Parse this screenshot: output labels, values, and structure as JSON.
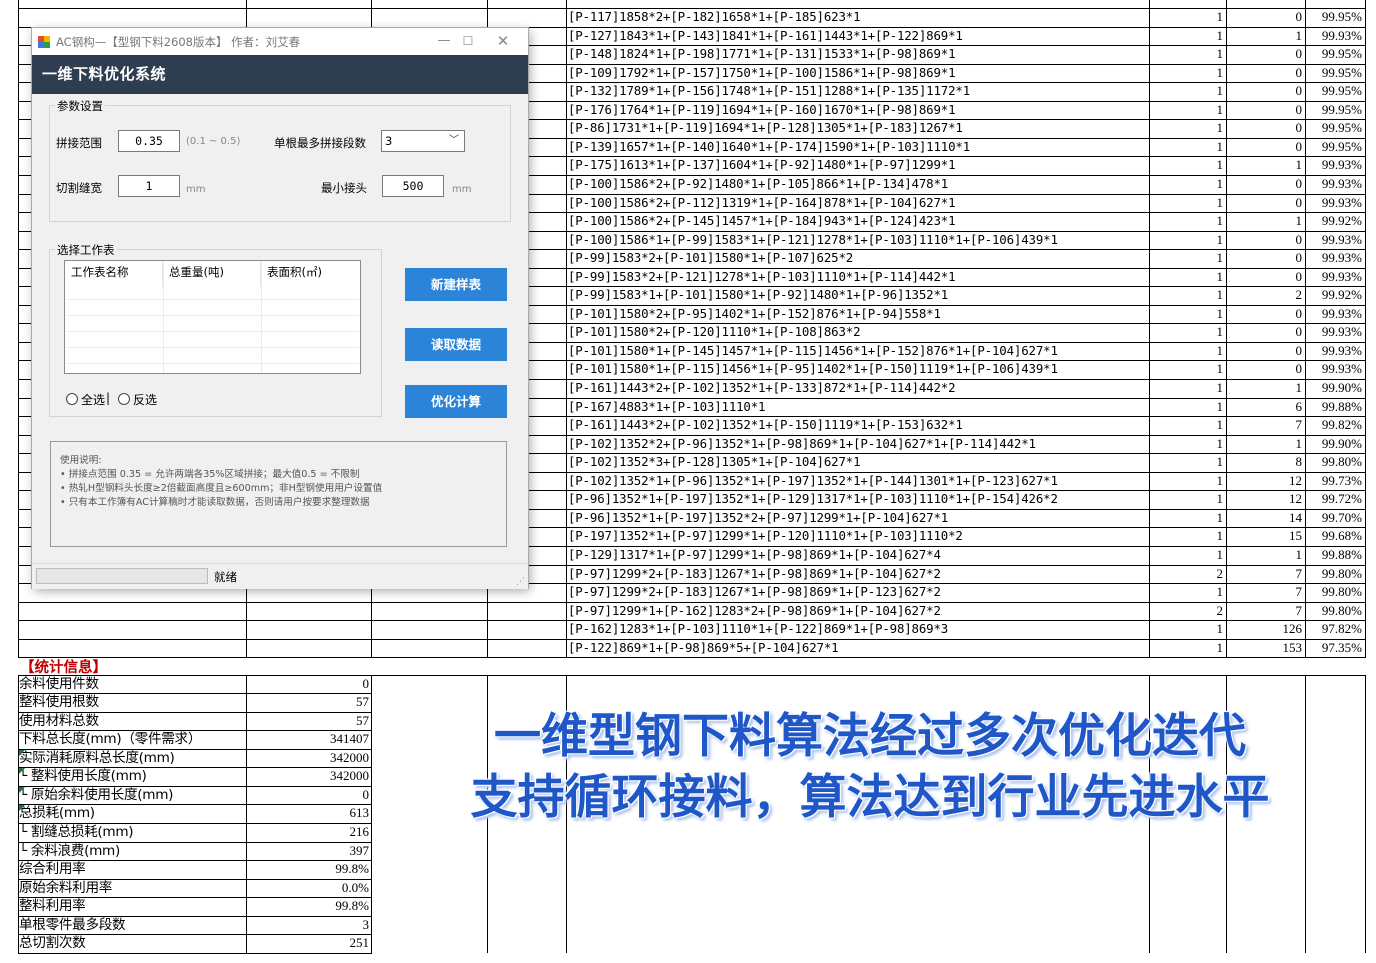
{
  "patterns": [
    {
      "text": "[P-117]1858*2+[P-182]1658*1+[P-185]623*1",
      "count": "1",
      "remnant": "0",
      "rate": "99.95%"
    },
    {
      "text": "[P-127]1843*1+[P-143]1841*1+[P-161]1443*1+[P-122]869*1",
      "count": "1",
      "remnant": "1",
      "rate": "99.93%"
    },
    {
      "text": "[P-148]1824*1+[P-198]1771*1+[P-131]1533*1+[P-98]869*1",
      "count": "1",
      "remnant": "0",
      "rate": "99.95%"
    },
    {
      "text": "[P-109]1792*1+[P-157]1750*1+[P-100]1586*1+[P-98]869*1",
      "count": "1",
      "remnant": "0",
      "rate": "99.95%"
    },
    {
      "text": "[P-132]1789*1+[P-156]1748*1+[P-151]1288*1+[P-135]1172*1",
      "count": "1",
      "remnant": "0",
      "rate": "99.95%"
    },
    {
      "text": "[P-176]1764*1+[P-119]1694*1+[P-160]1670*1+[P-98]869*1",
      "count": "1",
      "remnant": "0",
      "rate": "99.95%"
    },
    {
      "text": "[P-86]1731*1+[P-119]1694*1+[P-128]1305*1+[P-183]1267*1",
      "count": "1",
      "remnant": "0",
      "rate": "99.95%"
    },
    {
      "text": "[P-139]1657*1+[P-140]1640*1+[P-174]1590*1+[P-103]1110*1",
      "count": "1",
      "remnant": "0",
      "rate": "99.95%"
    },
    {
      "text": "[P-175]1613*1+[P-137]1604*1+[P-92]1480*1+[P-97]1299*1",
      "count": "1",
      "remnant": "1",
      "rate": "99.93%"
    },
    {
      "text": "[P-100]1586*2+[P-92]1480*1+[P-105]866*1+[P-134]478*1",
      "count": "1",
      "remnant": "0",
      "rate": "99.93%"
    },
    {
      "text": "[P-100]1586*2+[P-112]1319*1+[P-164]878*1+[P-104]627*1",
      "count": "1",
      "remnant": "0",
      "rate": "99.93%"
    },
    {
      "text": "[P-100]1586*2+[P-145]1457*1+[P-184]943*1+[P-124]423*1",
      "count": "1",
      "remnant": "1",
      "rate": "99.92%"
    },
    {
      "text": "[P-100]1586*1+[P-99]1583*1+[P-121]1278*1+[P-103]1110*1+[P-106]439*1",
      "count": "1",
      "remnant": "0",
      "rate": "99.93%"
    },
    {
      "text": "[P-99]1583*2+[P-101]1580*1+[P-107]625*2",
      "count": "1",
      "remnant": "0",
      "rate": "99.93%"
    },
    {
      "text": "[P-99]1583*2+[P-121]1278*1+[P-103]1110*1+[P-114]442*1",
      "count": "1",
      "remnant": "0",
      "rate": "99.93%"
    },
    {
      "text": "[P-99]1583*1+[P-101]1580*1+[P-92]1480*1+[P-96]1352*1",
      "count": "1",
      "remnant": "2",
      "rate": "99.92%"
    },
    {
      "text": "[P-101]1580*2+[P-95]1402*1+[P-152]876*1+[P-94]558*1",
      "count": "1",
      "remnant": "0",
      "rate": "99.93%"
    },
    {
      "text": "[P-101]1580*2+[P-120]1110*1+[P-108]863*2",
      "count": "1",
      "remnant": "0",
      "rate": "99.93%"
    },
    {
      "text": "[P-101]1580*1+[P-145]1457*1+[P-115]1456*1+[P-152]876*1+[P-104]627*1",
      "count": "1",
      "remnant": "0",
      "rate": "99.93%"
    },
    {
      "text": "[P-101]1580*1+[P-115]1456*1+[P-95]1402*1+[P-150]1119*1+[P-106]439*1",
      "count": "1",
      "remnant": "0",
      "rate": "99.93%"
    },
    {
      "text": "[P-161]1443*2+[P-102]1352*1+[P-133]872*1+[P-114]442*2",
      "count": "1",
      "remnant": "1",
      "rate": "99.90%"
    },
    {
      "text": "[P-167]4883*1+[P-103]1110*1",
      "count": "1",
      "remnant": "6",
      "rate": "99.88%"
    },
    {
      "text": "[P-161]1443*2+[P-102]1352*1+[P-150]1119*1+[P-153]632*1",
      "count": "1",
      "remnant": "7",
      "rate": "99.82%"
    },
    {
      "text": "[P-102]1352*2+[P-96]1352*1+[P-98]869*1+[P-104]627*1+[P-114]442*1",
      "count": "1",
      "remnant": "1",
      "rate": "99.90%"
    },
    {
      "text": "[P-102]1352*3+[P-128]1305*1+[P-104]627*1",
      "count": "1",
      "remnant": "8",
      "rate": "99.80%"
    },
    {
      "text": "[P-102]1352*1+[P-96]1352*1+[P-197]1352*1+[P-144]1301*1+[P-123]627*1",
      "count": "1",
      "remnant": "12",
      "rate": "99.73%"
    },
    {
      "text": "[P-96]1352*1+[P-197]1352*1+[P-129]1317*1+[P-103]1110*1+[P-154]426*2",
      "count": "1",
      "remnant": "12",
      "rate": "99.72%"
    },
    {
      "text": "[P-96]1352*1+[P-197]1352*2+[P-97]1299*1+[P-104]627*1",
      "count": "1",
      "remnant": "14",
      "rate": "99.70%"
    },
    {
      "text": "[P-197]1352*1+[P-97]1299*1+[P-120]1110*1+[P-103]1110*2",
      "count": "1",
      "remnant": "15",
      "rate": "99.68%"
    },
    {
      "text": "[P-129]1317*1+[P-97]1299*1+[P-98]869*1+[P-104]627*4",
      "count": "1",
      "remnant": "1",
      "rate": "99.88%"
    },
    {
      "text": "[P-97]1299*2+[P-183]1267*1+[P-98]869*1+[P-104]627*2",
      "count": "2",
      "remnant": "7",
      "rate": "99.80%"
    },
    {
      "text": "[P-97]1299*2+[P-183]1267*1+[P-98]869*1+[P-123]627*2",
      "count": "1",
      "remnant": "7",
      "rate": "99.80%"
    },
    {
      "text": "[P-97]1299*1+[P-162]1283*2+[P-98]869*1+[P-104]627*2",
      "count": "2",
      "remnant": "7",
      "rate": "99.80%"
    },
    {
      "text": "[P-162]1283*1+[P-103]1110*1+[P-122]869*1+[P-98]869*3",
      "count": "1",
      "remnant": "126",
      "rate": "97.82%"
    },
    {
      "text": "[P-122]869*1+[P-98]869*5+[P-104]627*1",
      "count": "1",
      "remnant": "153",
      "rate": "97.35%"
    }
  ],
  "stats": {
    "title": "【统计信息】",
    "rows": [
      {
        "label": "余料使用件数",
        "value": "0"
      },
      {
        "label": "整料使用根数",
        "value": "57"
      },
      {
        "label": "使用材料总数",
        "value": "57"
      },
      {
        "label": "下料总长度(mm)（零件需求）",
        "value": "341407"
      },
      {
        "label": "实际消耗原料总长度(mm)",
        "value": "342000"
      },
      {
        "label": "  └ 整料使用长度(mm)",
        "value": "342000"
      },
      {
        "label": "  └ 原始余料使用长度(mm)",
        "value": "0"
      },
      {
        "label": "总损耗(mm)",
        "value": "613"
      },
      {
        "label": "  └ 割缝总损耗(mm)",
        "value": "216"
      },
      {
        "label": "  └ 余料浪费(mm)",
        "value": "397"
      },
      {
        "label": "综合利用率",
        "value": "99.8%"
      },
      {
        "label": "原始余料利用率",
        "value": "0.0%"
      },
      {
        "label": "整料利用率",
        "value": "99.8%"
      },
      {
        "label": "单根零件最多段数",
        "value": "3"
      },
      {
        "label": "总切割次数",
        "value": "251"
      }
    ]
  },
  "banner": {
    "line1": "一维型钢下料算法经过多次优化迭代",
    "line2": "支持循环接料，算法达到行业先进水平"
  },
  "dialog": {
    "window_title": "AC钢构—【型钢下料2608版本】 作者：刘艾春",
    "header": "一维下料优化系统",
    "params_group": "参数设置",
    "splice_label": "拼接范围",
    "splice_value": "0.35",
    "splice_hint": "(0.1 ~ 0.5)",
    "max_segments_label": "单根最多拼接段数",
    "max_segments_value": "3",
    "kerf_label": "切割缝宽",
    "kerf_value": "1",
    "kerf_unit": "mm",
    "min_joint_label": "最小接头",
    "min_joint_value": "500",
    "min_joint_unit": "mm",
    "sheet_group": "选择工作表",
    "columns": [
      "工作表名称",
      "总重量(吨)",
      "表面积(㎡)"
    ],
    "select_all": "全选",
    "select_sep": "|",
    "invert": "反选",
    "btn_new": "新建样表",
    "btn_read": "读取数据",
    "btn_optimize": "优化计算",
    "notes_title": "使用说明:",
    "note1": "• 拼接点范围 0.35 = 允许两端各35%区域拼接；最大值0.5 = 不限制",
    "note2": "• 热轧H型钢料头长度≥2倍截面高度且≥600mm；非H型钢使用用户设置值",
    "note3": "• 只有本工作簿有AC计算稿时才能读取数据，否则请用户按要求整理数据",
    "status": "就绪"
  },
  "colors": {
    "header_bg": "#2e3d4f",
    "button_bg": "#2c84d9",
    "banner": "#1f56c8",
    "stats_title": "#c00000"
  }
}
